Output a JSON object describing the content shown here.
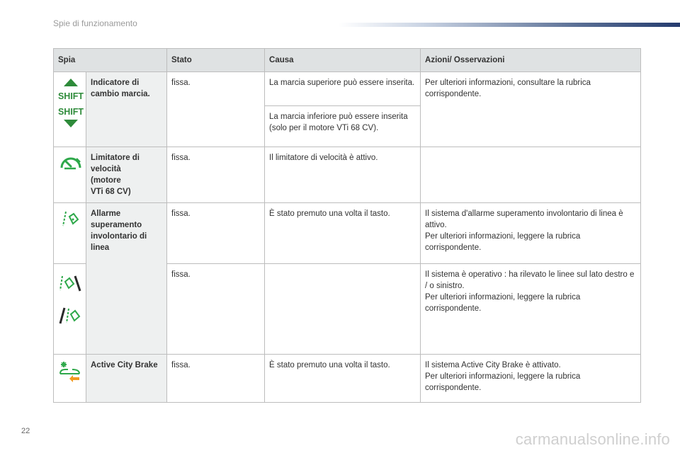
{
  "header": {
    "section_title": "Spie di funzionamento"
  },
  "page_number": "22",
  "watermark": "carmanualsonline.info",
  "table": {
    "columns": [
      "Spia",
      "Stato",
      "Causa",
      "Azioni/ Osservazioni"
    ],
    "shift": {
      "icon_text": "SHIFT",
      "name": "Indicatore di cambio marcia.",
      "state": "fissa.",
      "cause_up": "La marcia superiore può essere inserita.",
      "cause_down": "La marcia inferiore può essere inserita (solo per il motore VTi 68 CV).",
      "action": "Per ulteriori informazioni, consultare la rubrica corrispondente."
    },
    "limiter": {
      "name_1": "Limitatore di",
      "name_2": "velocità",
      "name_3": "(motore",
      "name_4": "VTi 68 CV)",
      "state": "fissa.",
      "cause": "Il limitatore di velocità è attivo.",
      "action": ""
    },
    "lane": {
      "name": "Allarme superamento involontario di linea",
      "row1": {
        "state": "fissa.",
        "cause": "È stato premuto una volta il tasto.",
        "action_1": "Il sistema d'allarme superamento involontario di linea è attivo.",
        "action_2": "Per ulteriori informazioni, leggere la rubrica corrispondente."
      },
      "row2": {
        "state": "fissa.",
        "cause": "",
        "action_1": "Il sistema è operativo : ha rilevato le linee sul lato destro e / o sinistro.",
        "action_2": "Per ulteriori informazioni, leggere la rubrica corrispondente."
      }
    },
    "acb": {
      "name": "Active City Brake",
      "state": "fissa.",
      "cause": "È stato premuto una volta il tasto.",
      "action_1": "Il sistema Active City Brake è attivato.",
      "action_2": "Per ulteriori informazioni, leggere la rubrica corrispondente."
    }
  },
  "colors": {
    "shift_green": "#2e8b3a",
    "indicator_green": "#2ea84a",
    "warning_orange": "#f29a1f",
    "header_gray": "#dfe2e3",
    "name_cell": "#eef0f0"
  }
}
